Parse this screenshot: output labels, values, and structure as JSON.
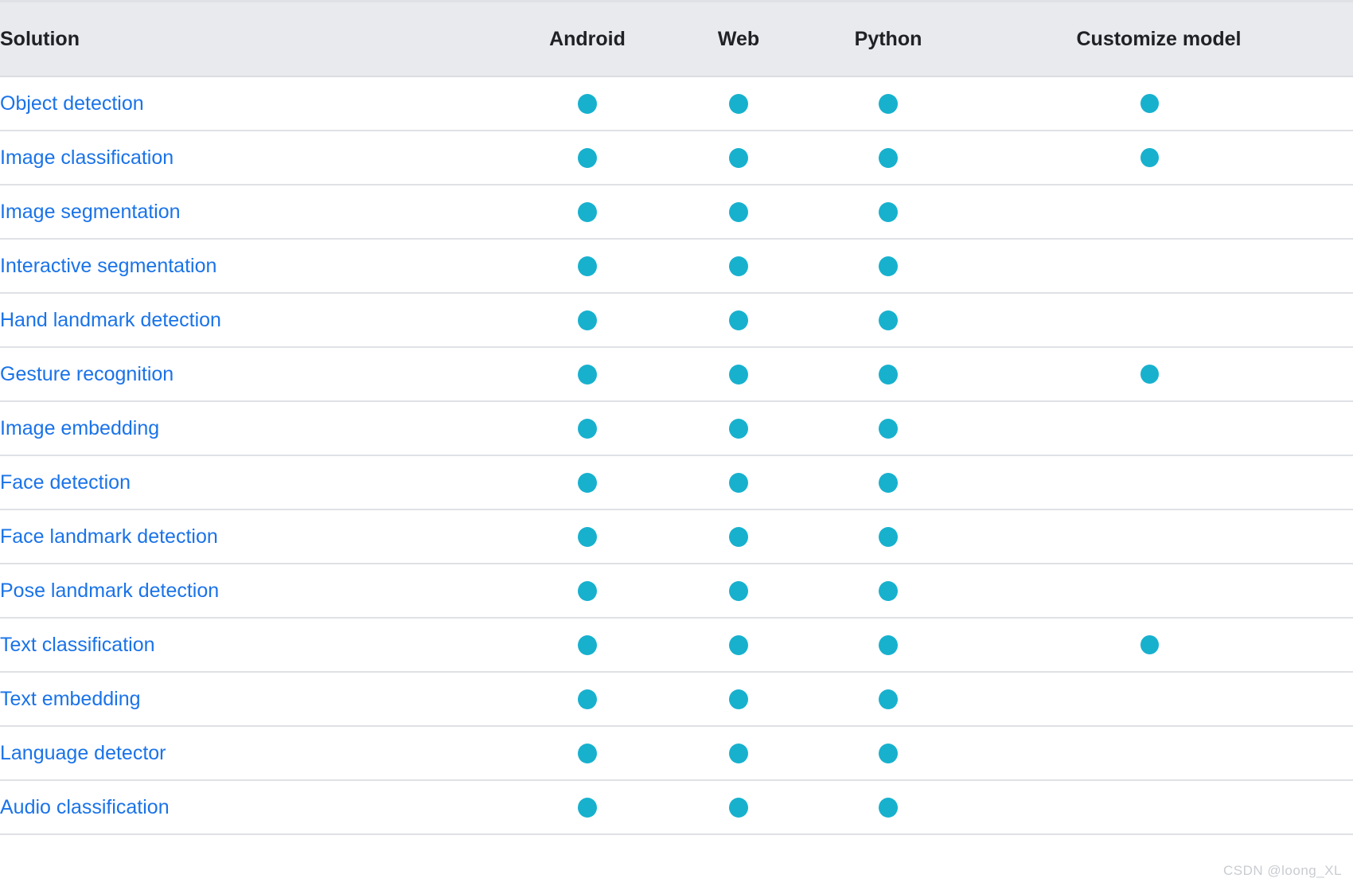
{
  "table": {
    "columns": [
      {
        "key": "solution",
        "label": "Solution",
        "align": "left"
      },
      {
        "key": "android",
        "label": "Android",
        "align": "center"
      },
      {
        "key": "web",
        "label": "Web",
        "align": "center"
      },
      {
        "key": "python",
        "label": "Python",
        "align": "center"
      },
      {
        "key": "customize",
        "label": "Customize model",
        "align": "center"
      }
    ],
    "rows": [
      {
        "solution": "Object detection",
        "android": true,
        "web": true,
        "python": true,
        "customize": true
      },
      {
        "solution": "Image classification",
        "android": true,
        "web": true,
        "python": true,
        "customize": true
      },
      {
        "solution": "Image segmentation",
        "android": true,
        "web": true,
        "python": true,
        "customize": false
      },
      {
        "solution": "Interactive segmentation",
        "android": true,
        "web": true,
        "python": true,
        "customize": false
      },
      {
        "solution": "Hand landmark detection",
        "android": true,
        "web": true,
        "python": true,
        "customize": false
      },
      {
        "solution": "Gesture recognition",
        "android": true,
        "web": true,
        "python": true,
        "customize": true
      },
      {
        "solution": "Image embedding",
        "android": true,
        "web": true,
        "python": true,
        "customize": false
      },
      {
        "solution": "Face detection",
        "android": true,
        "web": true,
        "python": true,
        "customize": false
      },
      {
        "solution": "Face landmark detection",
        "android": true,
        "web": true,
        "python": true,
        "customize": false
      },
      {
        "solution": "Pose landmark detection",
        "android": true,
        "web": true,
        "python": true,
        "customize": false
      },
      {
        "solution": "Text classification",
        "android": true,
        "web": true,
        "python": true,
        "customize": true
      },
      {
        "solution": "Text embedding",
        "android": true,
        "web": true,
        "python": true,
        "customize": false
      },
      {
        "solution": "Language detector",
        "android": true,
        "web": true,
        "python": true,
        "customize": false
      },
      {
        "solution": "Audio classification",
        "android": true,
        "web": true,
        "python": true,
        "customize": false
      }
    ]
  },
  "watermark": {
    "text": "CSDN @loong_XL"
  },
  "colors": {
    "dot": "#17b1ce",
    "link": "#1a73e8",
    "header_bg": "#e8eaed",
    "row_border": "#dfe1e5",
    "header_text": "#202124",
    "watermark": "#c9ccd1"
  },
  "icons": {
    "supported": "filled-circle-icon"
  }
}
